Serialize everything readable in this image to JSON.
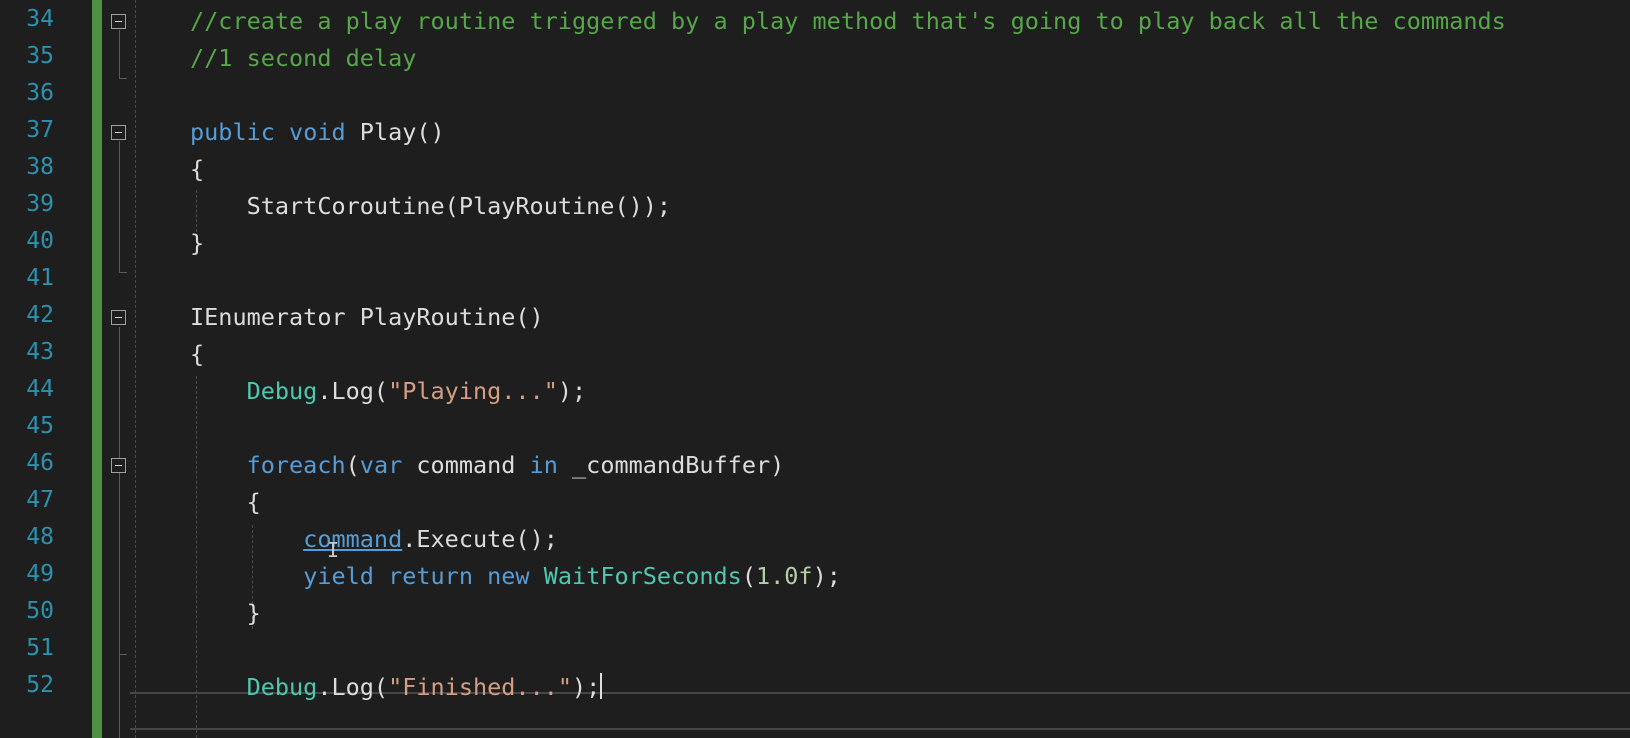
{
  "editor": {
    "theme": "dark",
    "colors": {
      "background": "#1e1e1e",
      "line_number": "#2b91af",
      "comment": "#57a64a",
      "keyword": "#569cd6",
      "type": "#4ec9b0",
      "string": "#d69d85",
      "number": "#b5cea8",
      "text": "#dcdcdc"
    },
    "lines": [
      {
        "no": "34",
        "tokens": [
          {
            "c": "cmt",
            "t": "//create a play routine triggered by a play method that's going to play back all the commands"
          }
        ]
      },
      {
        "no": "35",
        "tokens": [
          {
            "c": "cmt",
            "t": "//1 second delay"
          }
        ]
      },
      {
        "no": "36",
        "tokens": []
      },
      {
        "no": "37",
        "tokens": [
          {
            "c": "kw",
            "t": "public"
          },
          {
            "c": "plain",
            "t": " "
          },
          {
            "c": "kw",
            "t": "void"
          },
          {
            "c": "plain",
            "t": " Play()"
          }
        ]
      },
      {
        "no": "38",
        "tokens": [
          {
            "c": "plain",
            "t": "{"
          }
        ]
      },
      {
        "no": "39",
        "tokens": [
          {
            "c": "plain",
            "t": "    StartCoroutine(PlayRoutine());"
          }
        ]
      },
      {
        "no": "40",
        "tokens": [
          {
            "c": "plain",
            "t": "}"
          }
        ]
      },
      {
        "no": "41",
        "tokens": []
      },
      {
        "no": "42",
        "tokens": [
          {
            "c": "plain",
            "t": "IEnumerator PlayRoutine()"
          }
        ]
      },
      {
        "no": "43",
        "tokens": [
          {
            "c": "plain",
            "t": "{"
          }
        ]
      },
      {
        "no": "44",
        "tokens": [
          {
            "c": "plain",
            "t": "    "
          },
          {
            "c": "type",
            "t": "Debug"
          },
          {
            "c": "plain",
            "t": ".Log("
          },
          {
            "c": "str",
            "t": "\"Playing...\""
          },
          {
            "c": "plain",
            "t": ");"
          }
        ]
      },
      {
        "no": "45",
        "tokens": []
      },
      {
        "no": "46",
        "tokens": [
          {
            "c": "plain",
            "t": "    "
          },
          {
            "c": "kw",
            "t": "foreach"
          },
          {
            "c": "plain",
            "t": "("
          },
          {
            "c": "kw",
            "t": "var"
          },
          {
            "c": "plain",
            "t": " command "
          },
          {
            "c": "kw",
            "t": "in"
          },
          {
            "c": "plain",
            "t": " _commandBuffer)"
          }
        ]
      },
      {
        "no": "47",
        "tokens": [
          {
            "c": "plain",
            "t": "    {"
          }
        ]
      },
      {
        "no": "48",
        "tokens": [
          {
            "c": "plain",
            "t": "        "
          },
          {
            "c": "ref-underline",
            "t": "command"
          },
          {
            "c": "plain",
            "t": ".Execute();"
          }
        ]
      },
      {
        "no": "49",
        "tokens": [
          {
            "c": "plain",
            "t": "        "
          },
          {
            "c": "kw",
            "t": "yield"
          },
          {
            "c": "plain",
            "t": " "
          },
          {
            "c": "kw",
            "t": "return"
          },
          {
            "c": "plain",
            "t": " "
          },
          {
            "c": "kw",
            "t": "new"
          },
          {
            "c": "plain",
            "t": " "
          },
          {
            "c": "type",
            "t": "WaitForSeconds"
          },
          {
            "c": "plain",
            "t": "("
          },
          {
            "c": "num",
            "t": "1.0f"
          },
          {
            "c": "plain",
            "t": ");"
          }
        ]
      },
      {
        "no": "50",
        "tokens": [
          {
            "c": "plain",
            "t": "    }"
          }
        ]
      },
      {
        "no": "51",
        "tokens": []
      },
      {
        "no": "52",
        "tokens": [
          {
            "c": "plain",
            "t": "    "
          },
          {
            "c": "type",
            "t": "Debug"
          },
          {
            "c": "plain",
            "t": ".Log("
          },
          {
            "c": "str",
            "t": "\"Finished...\""
          },
          {
            "c": "plain",
            "t": ");"
          }
        ],
        "caret": true
      }
    ]
  }
}
